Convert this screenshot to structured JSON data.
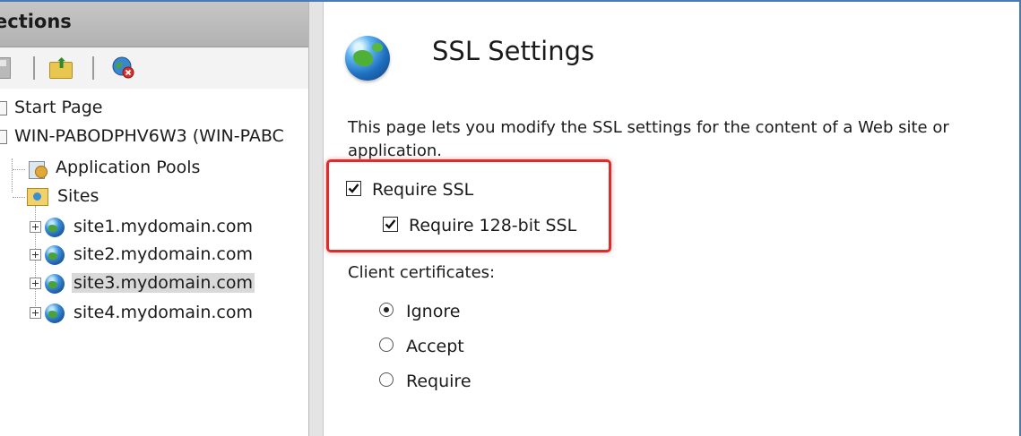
{
  "connections": {
    "title": "ections",
    "toolbar": {
      "icons": [
        "save-icon",
        "up-folder-icon",
        "disconnect-icon"
      ]
    },
    "tree": [
      {
        "label": "Start Page",
        "icon": "page-icon"
      },
      {
        "label": "WIN-PABODPHV6W3 (WIN-PABC",
        "icon": "server-icon"
      },
      {
        "label": "Application Pools",
        "icon": "app-pool-icon"
      },
      {
        "label": "Sites",
        "icon": "sites-folder-icon"
      },
      {
        "label": "site1.mydomain.com",
        "icon": "globe-icon"
      },
      {
        "label": "site2.mydomain.com",
        "icon": "globe-icon"
      },
      {
        "label": "site3.mydomain.com",
        "icon": "globe-icon",
        "selected": true
      },
      {
        "label": "site4.mydomain.com",
        "icon": "globe-icon"
      }
    ]
  },
  "main": {
    "title": "SSL Settings",
    "description": "This page lets you modify the SSL settings for the content of a Web site or application.",
    "require_ssl": {
      "label": "Require SSL",
      "checked": true
    },
    "require_128": {
      "label": "Require 128-bit SSL",
      "checked": true
    },
    "client_certificates": {
      "label": "Client certificates:",
      "options": [
        {
          "label": "Ignore",
          "selected": true
        },
        {
          "label": "Accept",
          "selected": false
        },
        {
          "label": "Require",
          "selected": false
        }
      ]
    }
  },
  "colors": {
    "highlight_border": "#e12a2a",
    "window_border": "#4b7bb5",
    "header_bg": "#b8b8b8",
    "selection_bg": "#d9d9d9"
  }
}
